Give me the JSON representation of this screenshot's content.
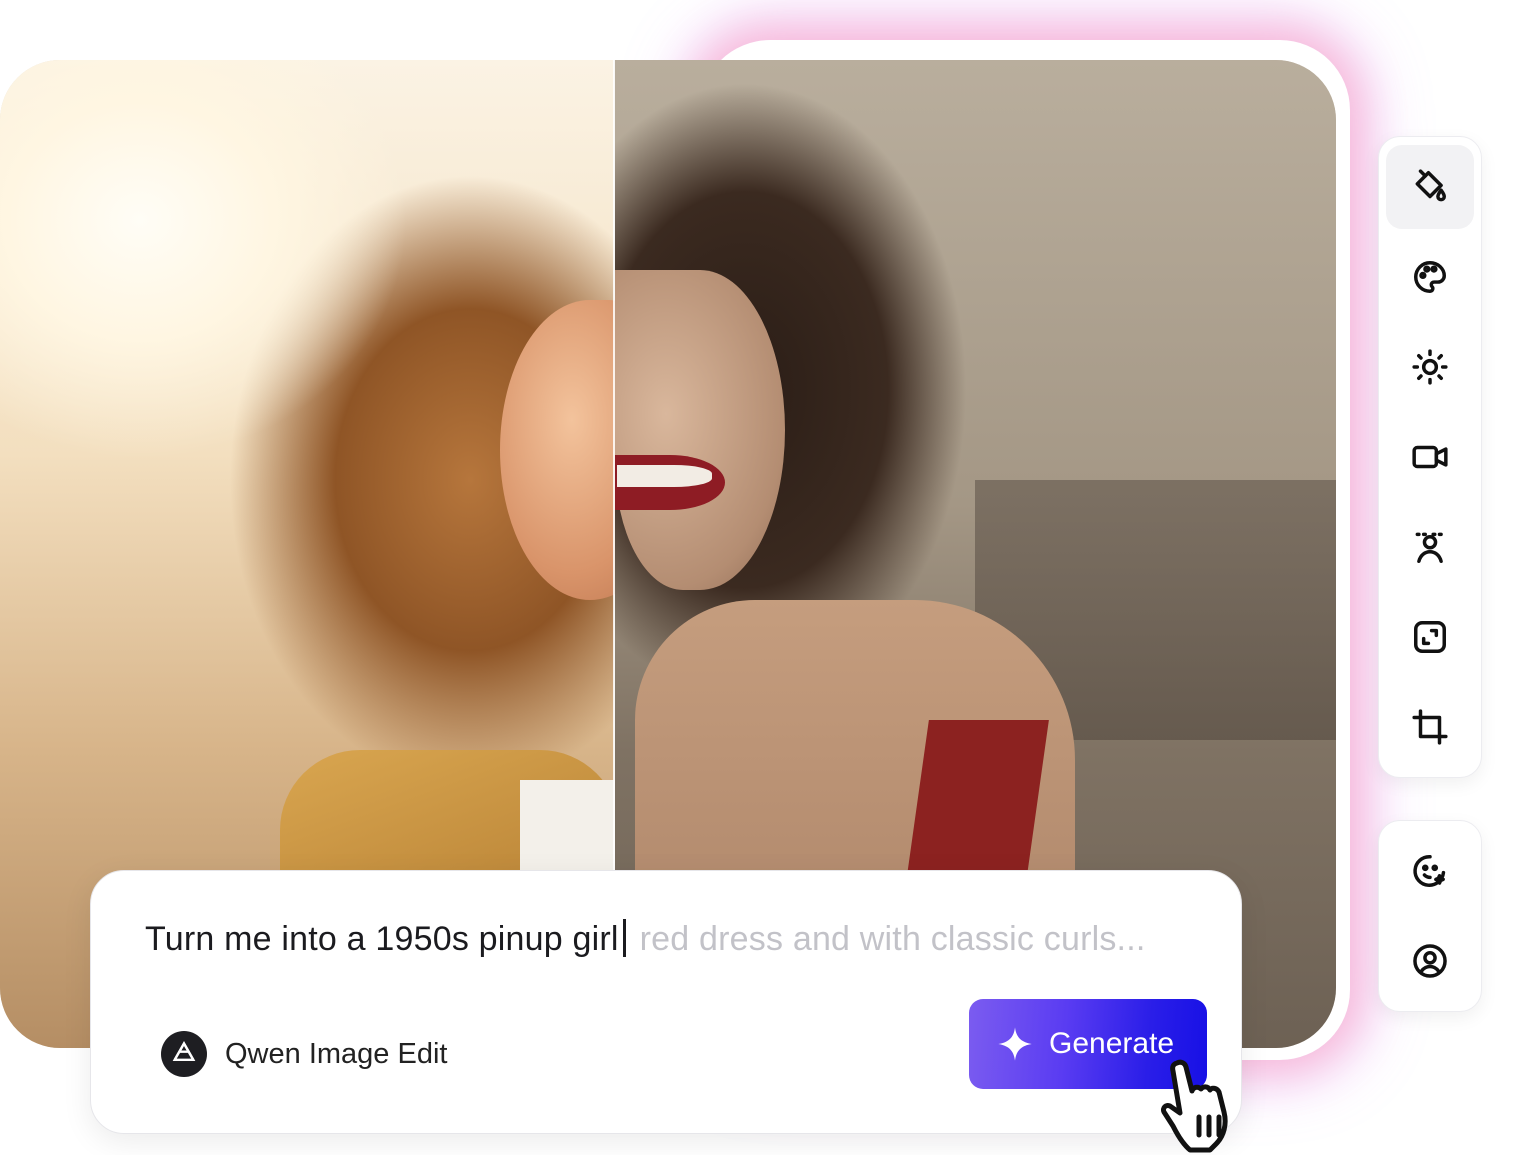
{
  "prompt": {
    "typed_text": "Turn me into a 1950s pinup girl",
    "placeholder_suggestion": "red dress and with classic curls..."
  },
  "model": {
    "name": "Qwen Image Edit",
    "icon": "qwen-logo-icon"
  },
  "generate_button": {
    "label": "Generate",
    "icon": "sparkle-icon",
    "gradient_start": "#7b5cf0",
    "gradient_end": "#1710e6"
  },
  "toolbar_primary": {
    "items": [
      {
        "name": "paint-bucket-icon",
        "active": true
      },
      {
        "name": "palette-icon",
        "active": false
      },
      {
        "name": "brightness-icon",
        "active": false
      },
      {
        "name": "video-icon",
        "active": false
      },
      {
        "name": "person-background-icon",
        "active": false
      },
      {
        "name": "resize-icon",
        "active": false
      },
      {
        "name": "crop-icon",
        "active": false
      }
    ]
  },
  "toolbar_secondary": {
    "items": [
      {
        "name": "face-sparkle-icon",
        "active": false
      },
      {
        "name": "user-circle-icon",
        "active": false
      }
    ]
  },
  "image_comparison": {
    "left": "original photo",
    "right": "edited 1950s pinup style"
  }
}
